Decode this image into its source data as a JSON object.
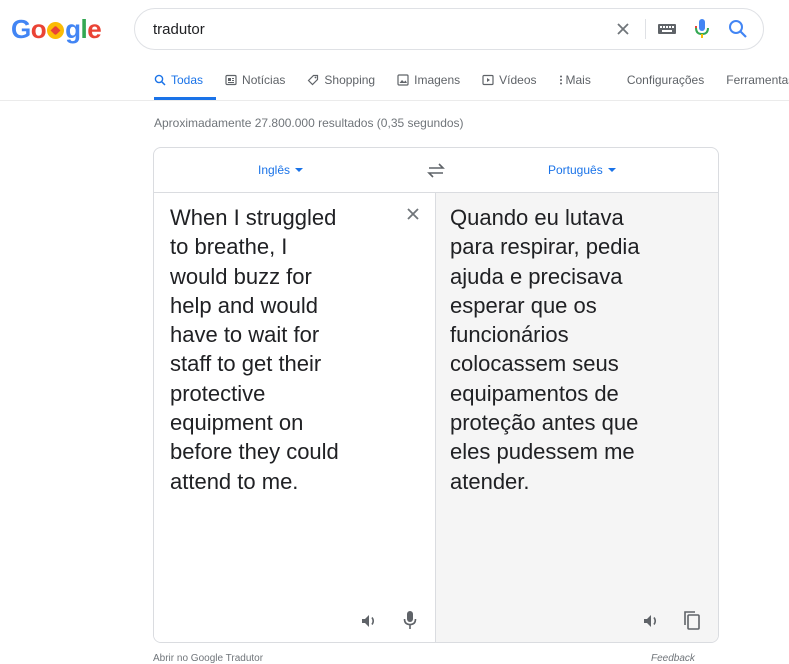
{
  "logo": {
    "letters": [
      "G",
      "o",
      "g",
      "l",
      "e"
    ],
    "colors": {
      "blue": "#4285f4",
      "red": "#ea4335",
      "yellow": "#fbbc05",
      "green": "#34a853"
    },
    "doodle_icon": "heart-doodle-icon"
  },
  "search": {
    "value": "tradutor",
    "icons": [
      "close-icon",
      "keyboard-icon",
      "mic-icon",
      "search-icon"
    ]
  },
  "tabs": [
    {
      "label": "Todas",
      "icon": "search-icon",
      "active": true
    },
    {
      "label": "Notícias",
      "icon": "news-icon",
      "active": false
    },
    {
      "label": "Shopping",
      "icon": "tag-icon",
      "active": false
    },
    {
      "label": "Imagens",
      "icon": "image-icon",
      "active": false
    },
    {
      "label": "Vídeos",
      "icon": "video-icon",
      "active": false
    },
    {
      "label": "Mais",
      "icon": "more-vert-icon",
      "active": false
    },
    {
      "label": "Configurações",
      "icon": "",
      "active": false
    },
    {
      "label": "Ferramentas",
      "icon": "",
      "active": false
    }
  ],
  "result_stats": "Aproximadamente 27.800.000 resultados (0,35 segundos)",
  "translator": {
    "source_lang": "Inglês",
    "target_lang": "Português",
    "source_text": "When I struggled\nto breathe, I\nwould buzz for\nhelp and would\nhave to wait for\nstaff to get their\nprotective\nequipment on\nbefore they could\nattend to me.",
    "target_text": "Quando eu lutava\npara respirar, pedia\najuda e precisava\nesperar que os\nfuncionários\ncolocassem seus\nequipamentos de\nproteção antes que\neles pudessem me\natender.",
    "accent_color": "#1a73e8"
  },
  "footer": {
    "open_link": "Abrir no Google Tradutor",
    "feedback": "Feedback"
  }
}
